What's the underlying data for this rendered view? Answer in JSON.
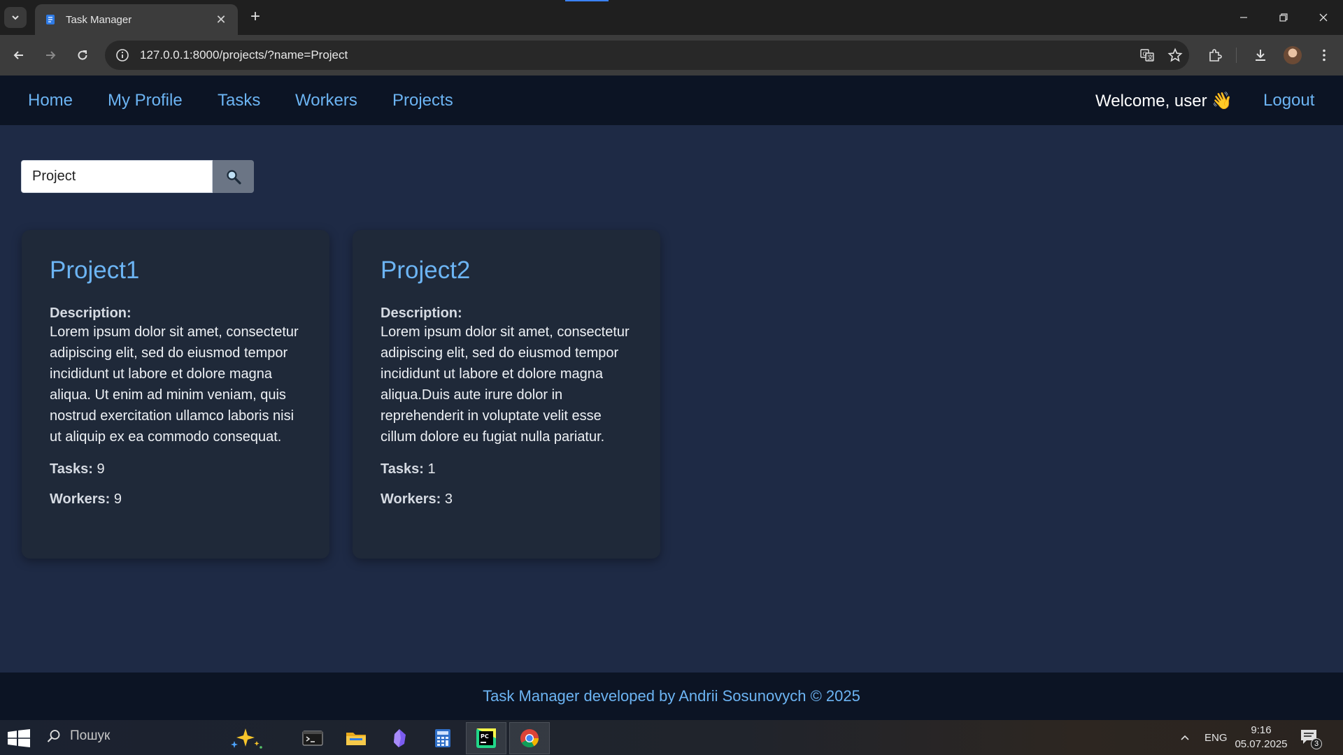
{
  "browser": {
    "tab_title": "Task Manager",
    "url": "127.0.0.1:8000/projects/?name=Project"
  },
  "nav": {
    "links": [
      "Home",
      "My Profile",
      "Tasks",
      "Workers",
      "Projects"
    ],
    "welcome": "Welcome, user 👋",
    "logout": "Logout"
  },
  "search": {
    "value": "Project"
  },
  "projects": [
    {
      "name": "Project1",
      "description_label": "Description:",
      "description": "Lorem ipsum dolor sit amet, consectetur adipiscing elit, sed do eiusmod tempor incididunt ut labore et dolore magna aliqua. Ut enim ad minim veniam, quis nostrud exercitation ullamco laboris nisi ut aliquip ex ea commodo consequat.",
      "tasks_label": "Tasks:",
      "tasks": "9",
      "workers_label": "Workers:",
      "workers": "9"
    },
    {
      "name": "Project2",
      "description_label": "Description:",
      "description": "Lorem ipsum dolor sit amet, consectetur adipiscing elit, sed do eiusmod tempor incididunt ut labore et dolore magna aliqua.Duis aute irure dolor in reprehenderit in voluptate velit esse cillum dolore eu fugiat nulla pariatur.",
      "tasks_label": "Tasks:",
      "tasks": "1",
      "workers_label": "Workers:",
      "workers": "3"
    }
  ],
  "footer": {
    "text": "Task Manager developed by Andrii Sosunovych © 2025"
  },
  "taskbar": {
    "search_text": "Пошук",
    "language": "ENG",
    "time": "9:16",
    "date": "05.07.2025",
    "notification_count": "3"
  },
  "colors": {
    "nav_bg": "#0c1424",
    "page_bg": "#1e2a45",
    "card_bg": "#1f2939",
    "link": "#6cb4f3"
  }
}
